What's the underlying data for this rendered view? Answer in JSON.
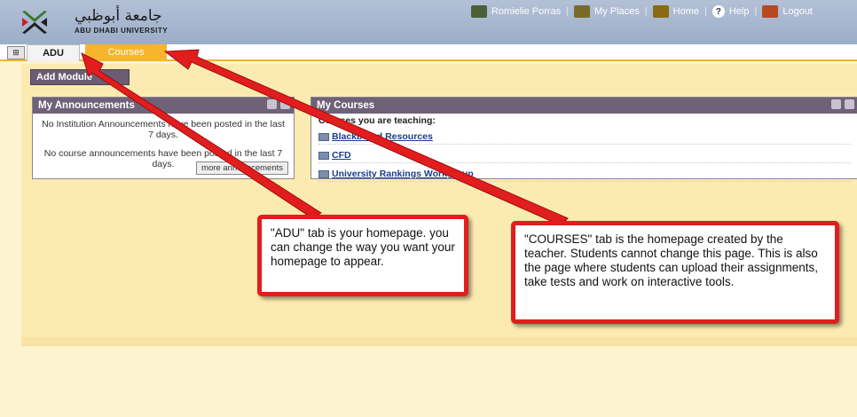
{
  "header": {
    "logo_arabic": "جامعة أبوظبي",
    "logo_english": "ABU DHABI UNIVERSITY",
    "nav": [
      {
        "label": "Romielie Porras",
        "icon": "user-icon"
      },
      {
        "label": "My Places",
        "icon": "places-icon"
      },
      {
        "label": "Home",
        "icon": "home-icon"
      },
      {
        "label": "Help",
        "icon": "help-icon"
      },
      {
        "label": "Logout",
        "icon": "logout-icon"
      }
    ]
  },
  "tabs": {
    "toggle": "⊞",
    "adu": "ADU",
    "courses": "Courses"
  },
  "add_module": "Add Module",
  "announcements": {
    "title": "My Announcements",
    "institution": "No Institution Announcements have been posted in the last 7 days.",
    "course": "No course announcements have been posted in the last 7 days.",
    "more": "more announcements"
  },
  "courses": {
    "title": "My Courses",
    "teaching": "Courses you are teaching:",
    "items": [
      "Blackboard Resources",
      "CFD",
      "University Rankings Workgroup"
    ]
  },
  "callouts": {
    "adu": "\"ADU\" tab is your homepage. you can change the way you want your homepage to appear.",
    "courses": "\"COURSES\" tab is the homepage created by the teacher. Students cannot change this page. This is also the page where students can upload their assignments, take tests and work on interactive tools."
  },
  "colors": {
    "header": "#9cadc8",
    "accent": "#f7b52d",
    "module_header": "#6f6178",
    "callout_border": "#e21d1d",
    "content_bg": "#fcebb0"
  }
}
